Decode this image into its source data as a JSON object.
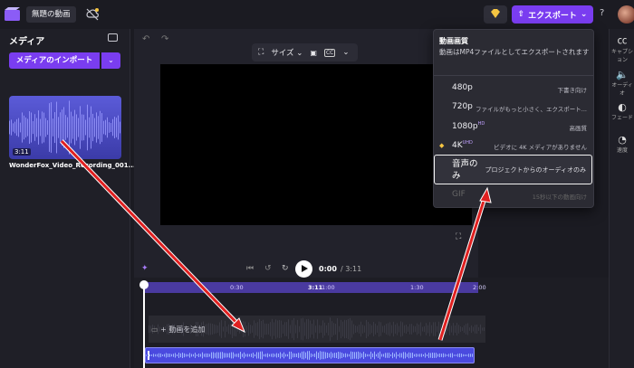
{
  "topbar": {
    "project_name": "無題の動画",
    "export_label": "エクスポート",
    "help_label": "?"
  },
  "media": {
    "title": "メディア",
    "import_label": "メディアのインポート",
    "thumb_duration": "3:11",
    "file_name": "WonderFox_Video_Recording_001..."
  },
  "toolbar": {
    "size_label": "サイズ"
  },
  "playback": {
    "current_time": "0:00",
    "total_time": "/ 3:11"
  },
  "timeline": {
    "ticks": [
      "0:30",
      "3:11",
      "1:00",
      "1:30",
      "2:00"
    ],
    "add_video_label": "+ 動画を追加"
  },
  "right_rail": {
    "items": [
      "キャプション",
      "オーディオ",
      "フェード",
      "速度"
    ]
  },
  "export_menu": {
    "heading": "動画画質",
    "description": "動画はMP4ファイルとしてエクスポートされます",
    "options": [
      {
        "label": "480p",
        "sup": "",
        "sub": "下書き向け"
      },
      {
        "label": "720p",
        "sup": "",
        "sub": "ファイルがもっと小さく、エクスポート..."
      },
      {
        "label": "1080p",
        "sup": "HD",
        "sub": "高画質"
      },
      {
        "label": "4K",
        "sup": "UHD",
        "sub": "ビデオに 4K メディアがありません"
      }
    ],
    "audio_only": {
      "label": "音声のみ",
      "sub": "プロジェクトからのオーディオのみ"
    },
    "gif": {
      "label": "GIF",
      "sub": "15秒以下の動画向け"
    }
  },
  "colors": {
    "accent": "#7a3df0",
    "annotation_arrow": "#e02020"
  }
}
